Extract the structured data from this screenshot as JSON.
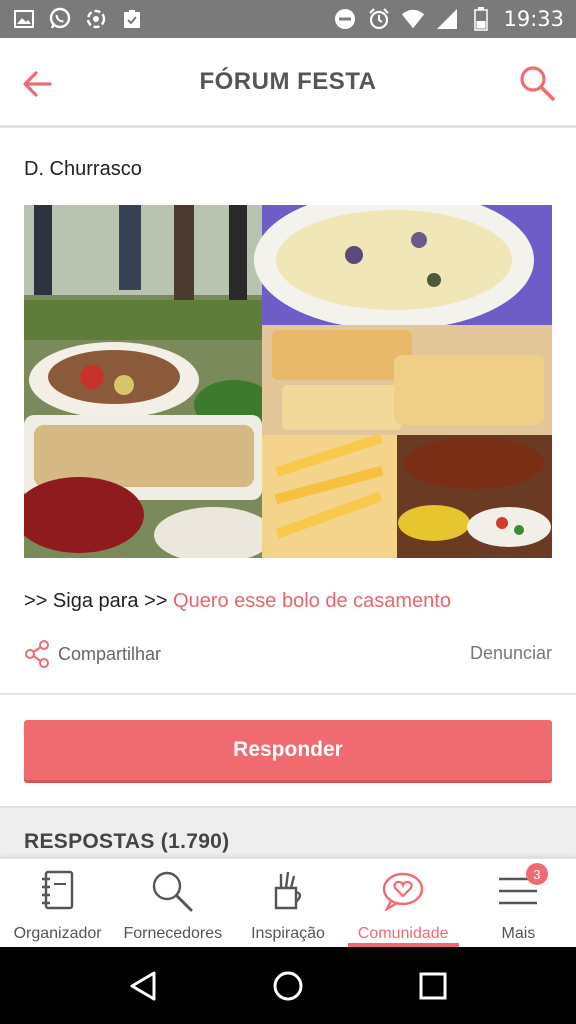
{
  "status_bar": {
    "time": "19:33",
    "left_icons": [
      "image-icon",
      "whatsapp-icon",
      "sync-icon",
      "clipboard-check-icon"
    ],
    "right_icons": [
      "do-not-disturb-icon",
      "alarm-icon",
      "wifi-icon",
      "signal-icon",
      "battery-icon"
    ]
  },
  "app_bar": {
    "title": "FÓRUM FESTA",
    "back_icon": "arrow-left-icon",
    "search_icon": "search-icon"
  },
  "post": {
    "title": "D. Churrasco",
    "follow_prefix": ">> Siga para >> ",
    "follow_link": "Quero esse bolo de casamento",
    "share_label": "Compartilhar",
    "report_label": "Denunciar"
  },
  "reply_button": "Responder",
  "answers": {
    "title": "RESPOSTAS (1.790)"
  },
  "tabs": [
    {
      "label": "Organizador",
      "icon": "notebook-icon",
      "active": false
    },
    {
      "label": "Fornecedores",
      "icon": "magnifier-icon",
      "active": false
    },
    {
      "label": "Inspiração",
      "icon": "pencil-cup-icon",
      "active": false
    },
    {
      "label": "Comunidade",
      "icon": "heart-bubble-icon",
      "active": true
    },
    {
      "label": "Mais",
      "icon": "menu-icon",
      "active": false,
      "badge": "3"
    }
  ],
  "colors": {
    "accent": "#f06b70",
    "status_bar": "#7a7a7a",
    "nav_bar": "#000000"
  }
}
